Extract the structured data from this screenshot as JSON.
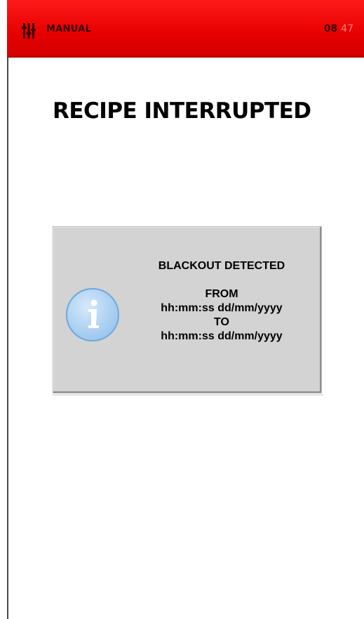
{
  "header": {
    "mode_label": "MANUAL",
    "clock_hours": "08",
    "clock_minutes": "47",
    "menu_icon": "menu-sliders-icon",
    "bar_color": "#e60000"
  },
  "main": {
    "title": "RECIPE INTERRUPTED"
  },
  "dialog": {
    "icon": "info-icon",
    "heading": "BLACKOUT DETECTED",
    "from_label": "FROM",
    "from_value": "hh:mm:ss dd/mm/yyyy",
    "to_label": "TO",
    "to_value": "hh:mm:ss dd/mm/yyyy",
    "background_color": "#d3d3d3"
  }
}
